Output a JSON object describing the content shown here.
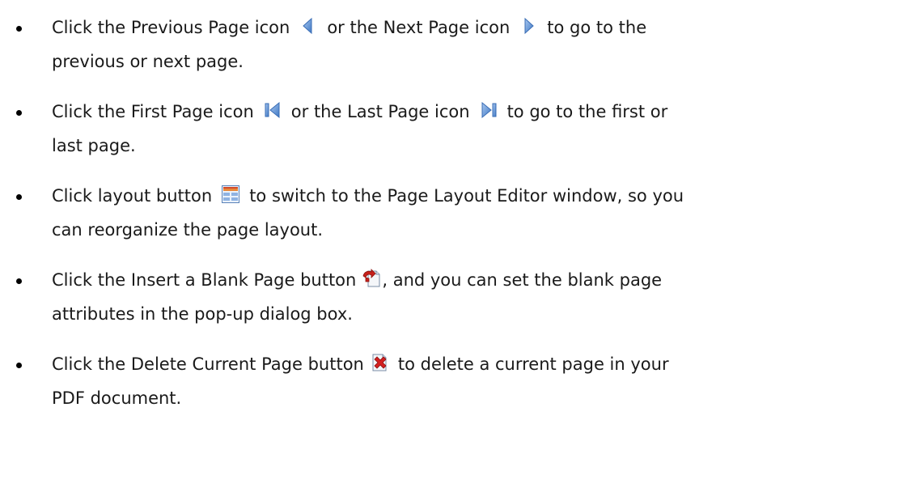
{
  "items": [
    {
      "part1": "Click the Previous Page icon",
      "part2": "or the Next Page icon",
      "part3": "to go to the",
      "line2": "previous or next page.",
      "icon_a": "previous-page-icon",
      "icon_b": "next-page-icon"
    },
    {
      "part1": "Click the First Page icon",
      "part2": "or the Last Page icon",
      "part3": "to go to the first or",
      "line2": "last page.",
      "icon_a": "first-page-icon",
      "icon_b": "last-page-icon"
    },
    {
      "part1": "Click layout button",
      "part2": "to switch to the Page Layout Editor window, so you",
      "line2": "can reorganize the page layout.",
      "icon_a": "page-layout-icon"
    },
    {
      "part1": "Click the Insert a Blank Page button",
      "part2": ", and you can set the blank page",
      "line2": "attributes in the pop-up dialog box.",
      "icon_a": "insert-blank-page-icon"
    },
    {
      "part1": "Click the Delete Current Page button",
      "part2": "to delete a current page in your",
      "line2": "PDF document.",
      "icon_a": "delete-page-icon"
    }
  ],
  "colors": {
    "text": "#1a1a1a",
    "arrow_blue": "#5b8fd4",
    "delete_red": "#d42020",
    "insert_red": "#c8201b"
  }
}
